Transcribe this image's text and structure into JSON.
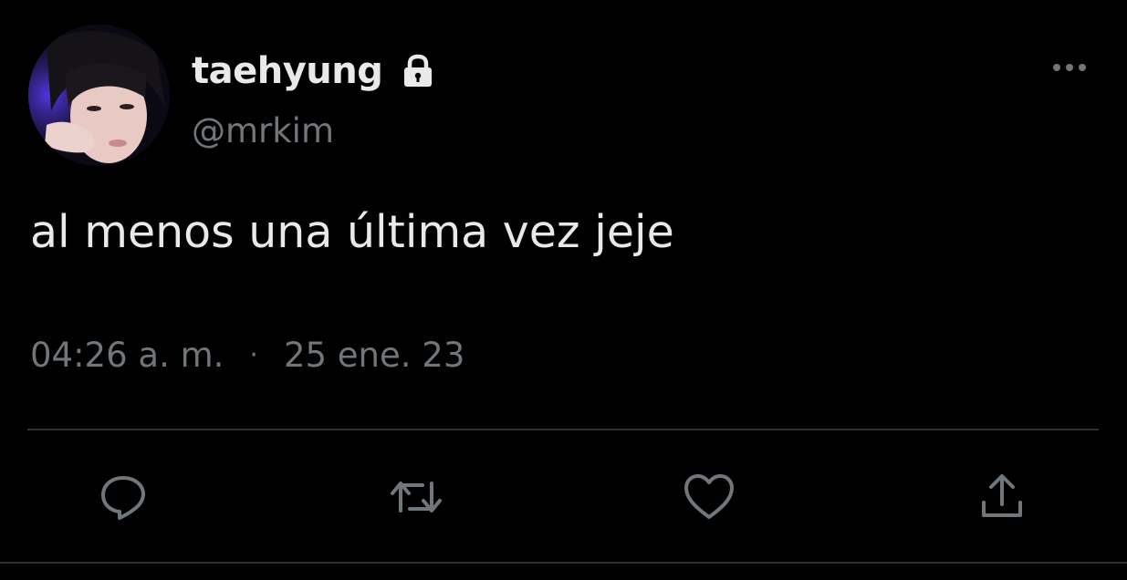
{
  "tweet": {
    "author": {
      "display_name": "taehyung",
      "handle": "@mrkim",
      "protected": true
    },
    "text": "al menos una última vez jeje",
    "time": "04:26 a. m.",
    "separator": "·",
    "date": "25 ene. 23"
  },
  "icons": {
    "lock": "lock-icon",
    "more": "more-horizontal-icon",
    "reply": "reply-icon",
    "retweet": "retweet-icon",
    "like": "heart-icon",
    "share": "share-icon"
  },
  "colors": {
    "background": "#000000",
    "primary_text": "#e7e9ea",
    "secondary_text": "#71767b",
    "divider": "#2f3336"
  }
}
